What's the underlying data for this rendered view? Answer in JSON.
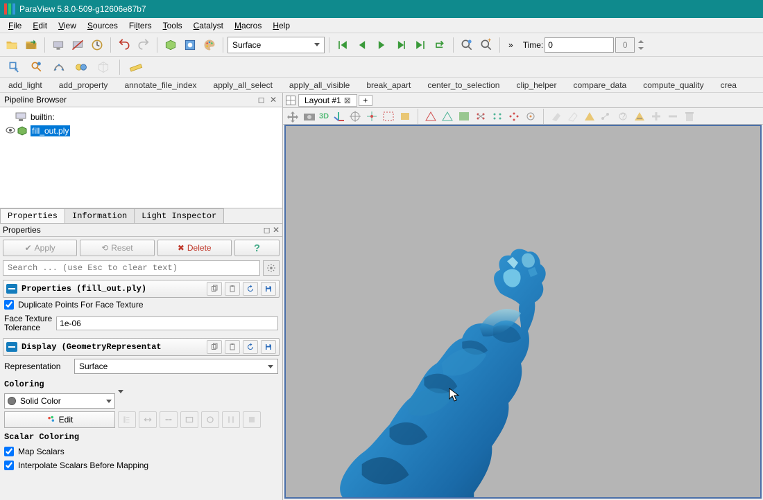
{
  "titlebar": {
    "title": "ParaView 5.8.0-509-g12606e87b7"
  },
  "menubar": {
    "items": [
      {
        "label": "File",
        "u": "F"
      },
      {
        "label": "Edit",
        "u": "E"
      },
      {
        "label": "View",
        "u": "V"
      },
      {
        "label": "Sources",
        "u": "S"
      },
      {
        "label": "Filters",
        "u": "l"
      },
      {
        "label": "Tools",
        "u": "T"
      },
      {
        "label": "Catalyst",
        "u": "C"
      },
      {
        "label": "Macros",
        "u": "M"
      },
      {
        "label": "Help",
        "u": "H"
      }
    ]
  },
  "toolbar": {
    "representation": "Surface",
    "time_label": "Time:",
    "time_value": "0",
    "time_step": "0"
  },
  "commands": [
    "add_light",
    "add_property",
    "annotate_file_index",
    "apply_all_select",
    "apply_all_visible",
    "break_apart",
    "center_to_selection",
    "clip_helper",
    "compare_data",
    "compute_quality",
    "crea"
  ],
  "pipeline": {
    "title": "Pipeline Browser",
    "root": "builtin:",
    "item": "fill_out.ply"
  },
  "tabs": {
    "properties": "Properties",
    "information": "Information",
    "light": "Light Inspector"
  },
  "props": {
    "header": "Properties",
    "apply": "Apply",
    "reset": "Reset",
    "delete": "Delete",
    "help": "?",
    "search_placeholder": "Search ... (use Esc to clear text)",
    "section_properties": "Properties (fill_out.ply)",
    "dup_points": "Duplicate Points For Face Texture",
    "face_tol_label1": "Face Texture",
    "face_tol_label2": "Tolerance",
    "face_tol_value": "1e-06",
    "section_display": "Display (GeometryRepresentat",
    "repr_label": "Representation",
    "repr_value": "Surface",
    "coloring": "Coloring",
    "solid_color": "Solid Color",
    "edit": "Edit",
    "scalar_coloring": "Scalar Coloring",
    "map_scalars": "Map Scalars",
    "interpolate": "Interpolate Scalars Before Mapping"
  },
  "layout": {
    "tab": "Layout #1",
    "threed": "3D"
  }
}
